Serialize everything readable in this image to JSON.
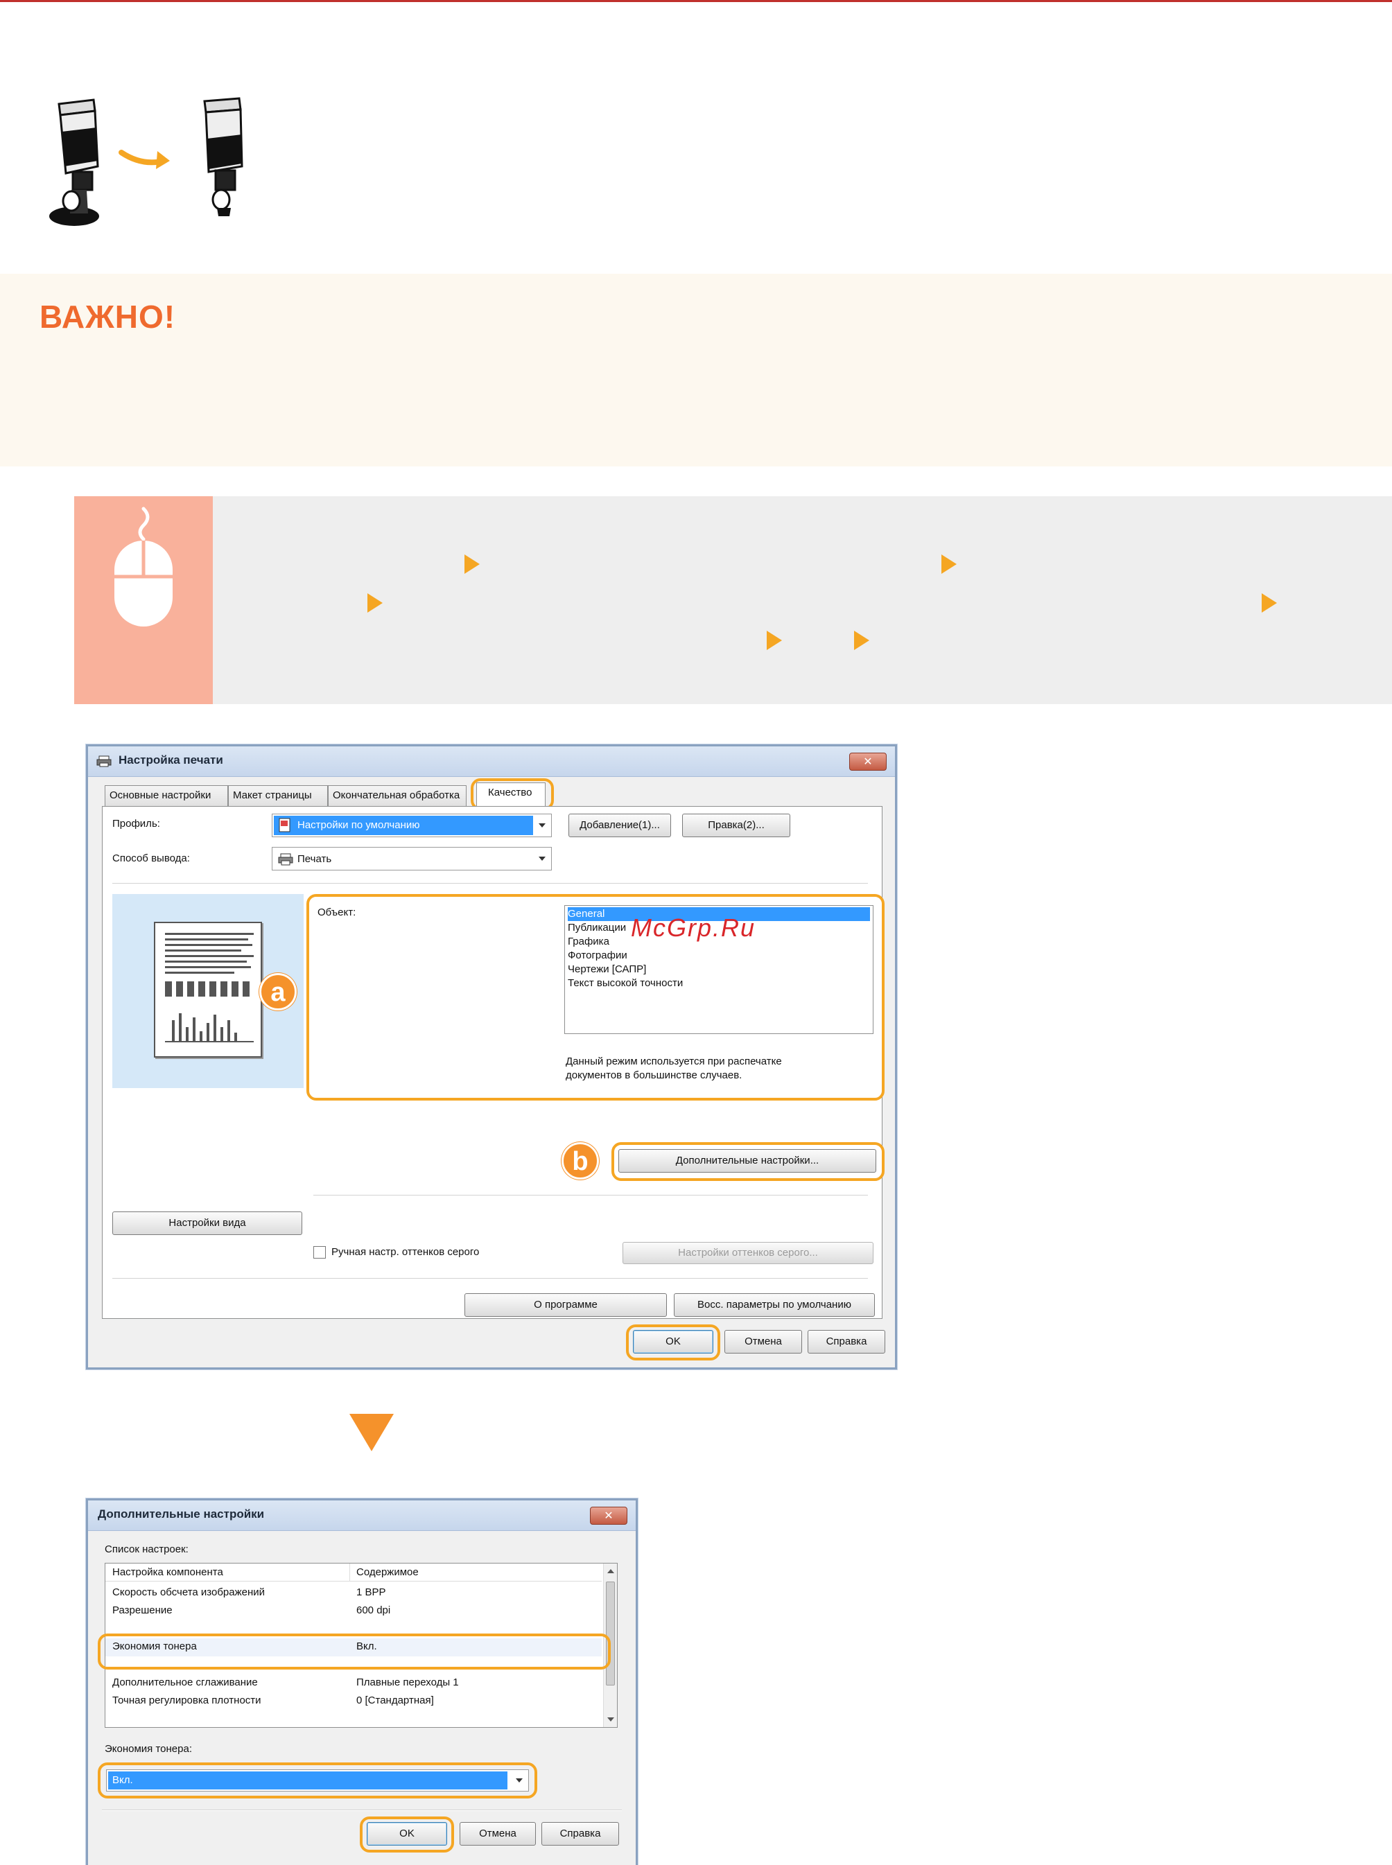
{
  "important": {
    "title": "ВАЖНО!"
  },
  "watermark": "McGrp.Ru",
  "icons": {
    "toner": "toner-bottle-icon",
    "mouse": "mouse-icon",
    "nav_arrow": "triangle-right-icon",
    "next_step": "triangle-down-icon"
  },
  "colors": {
    "accent": "#f5a623",
    "important": "#ef6a2e",
    "top_rule": "#c0302c",
    "mouse_tile": "#f9b19b"
  },
  "dialog1": {
    "title": "Настройка печати",
    "close": "✕",
    "tabs": [
      "Основные настройки",
      "Макет страницы",
      "Окончательная обработка",
      "Качество"
    ],
    "profile_label": "Профиль:",
    "profile_value": "Настройки по умолчанию",
    "add_button": "Добавление(1)...",
    "edit_button": "Правка(2)...",
    "output_label": "Способ вывода:",
    "output_value": "Печать",
    "object_label": "Объект:",
    "object_items": [
      "General",
      "Публикации",
      "Графика",
      "Фотографии",
      "Чертежи [САПР]",
      "Текст высокой точности"
    ],
    "object_description": "Данный режим используется при распечатке документов в большинстве случаев.",
    "badge_a": "a",
    "badge_b": "b",
    "advanced_button": "Дополнительные настройки...",
    "view_settings_button": "Настройки вида",
    "gray_checkbox_label": "Ручная настр. оттенков серого",
    "gray_settings_button": "Настройки оттенков серого...",
    "about_button": "О программе",
    "restore_button": "Восс. параметры по умолчанию",
    "ok": "OK",
    "cancel": "Отмена",
    "help": "Справка"
  },
  "dialog2": {
    "title": "Дополнительные настройки",
    "close": "✕",
    "list_label": "Список настроек:",
    "columns": [
      "Настройка компонента",
      "Содержимое"
    ],
    "rows": [
      [
        "Скорость обсчета изображений",
        "1 BPP"
      ],
      [
        "Разрешение",
        "600 dpi"
      ],
      [
        "Экономия тонера",
        "Вкл."
      ],
      [
        "Дополнительное сглаживание",
        "Плавные переходы 1"
      ],
      [
        "Точная регулировка плотности",
        "0 [Стандартная]"
      ]
    ],
    "toner_label": "Экономия тонера:",
    "toner_value": "Вкл.",
    "ok": "OK",
    "cancel": "Отмена",
    "help": "Справка"
  }
}
